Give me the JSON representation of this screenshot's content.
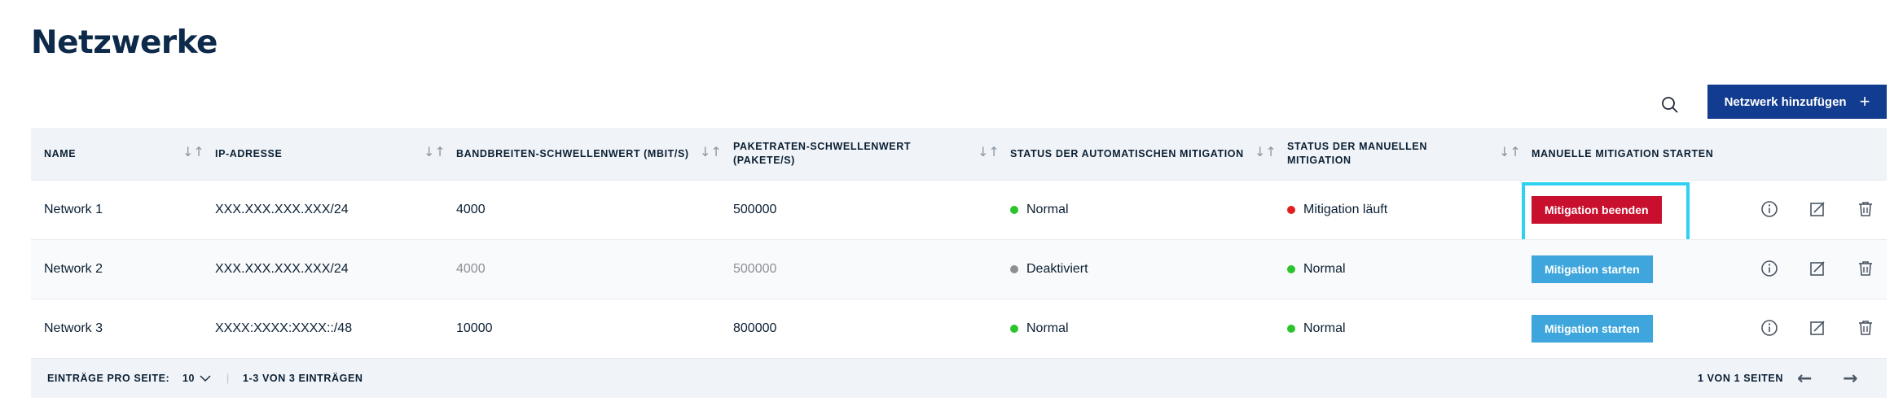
{
  "page": {
    "title": "Netzwerke"
  },
  "toolbar": {
    "add_label": "Netzwerk hinzufügen",
    "add_icon": "plus-icon",
    "search_icon": "search-icon"
  },
  "table": {
    "columns": [
      "Name",
      "IP-Adresse",
      "Bandbreiten-Schwellenwert (Mbit/s)",
      "Paketraten-Schwellenwert (Pakete/s)",
      "Status der automatischen Mitigation",
      "Status der manuellen Mitigation",
      "Manuelle Mitigation starten"
    ],
    "rows": [
      {
        "name": "Network 1",
        "ip": "XXX.XXX.XXX.XXX/24",
        "bandwidth": "4000",
        "packets": "500000",
        "auto_status": "Normal",
        "auto_color": "#2bc42b",
        "manual_status": "Mitigation läuft",
        "manual_color": "#e02020",
        "action": "Mitigation beenden",
        "action_color": "#c8102e"
      },
      {
        "name": "Network 2",
        "ip": "XXX.XXX.XXX.XXX/24",
        "bandwidth": "4000",
        "packets": "500000",
        "auto_status": "Deaktiviert",
        "auto_color": "#8f8f8f",
        "manual_status": "Normal",
        "manual_color": "#2bc42b",
        "action": "Mitigation starten",
        "action_color": "#3ea6dc"
      },
      {
        "name": "Network 3",
        "ip": "XXXX:XXXX:XXXX::/48",
        "bandwidth": "10000",
        "packets": "800000",
        "auto_status": "Normal",
        "auto_color": "#2bc42b",
        "manual_status": "Normal",
        "manual_color": "#2bc42b",
        "action": "Mitigation starten",
        "action_color": "#3ea6dc"
      }
    ],
    "row_icons": [
      "info-icon",
      "edit-icon",
      "trash-icon"
    ]
  },
  "footer": {
    "per_page_label": "Einträge pro Seite:",
    "per_page_value": "10",
    "range": "1-3 von 3 Einträgen",
    "pages": "1 von 1 Seiten"
  }
}
